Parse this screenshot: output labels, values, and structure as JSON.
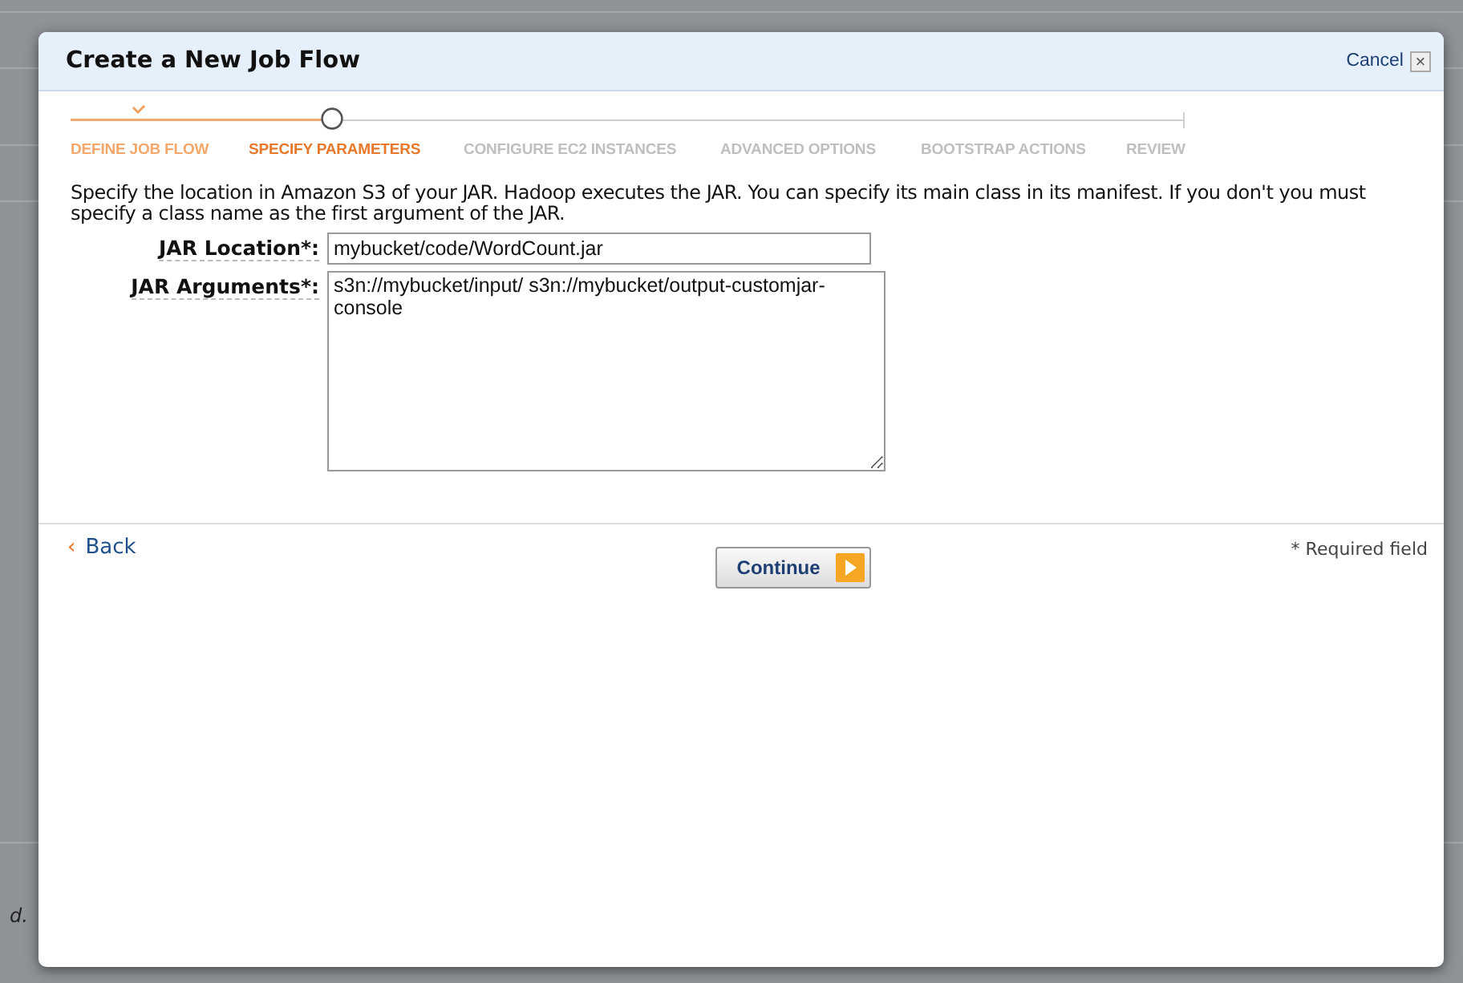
{
  "background": {
    "text_fragment": "d."
  },
  "dialog": {
    "title": "Create a New Job Flow",
    "cancel": "Cancel",
    "close_icon": "×"
  },
  "steps": [
    {
      "label": "DEFINE JOB FLOW",
      "completed": true,
      "selected": false
    },
    {
      "label": "SPECIFY PARAMETERS",
      "completed": false,
      "selected": true
    },
    {
      "label": "CONFIGURE EC2 INSTANCES",
      "completed": false,
      "selected": false
    },
    {
      "label": "ADVANCED OPTIONS",
      "completed": false,
      "selected": false
    },
    {
      "label": "BOOTSTRAP ACTIONS",
      "completed": false,
      "selected": false
    },
    {
      "label": "REVIEW",
      "completed": false,
      "selected": false
    }
  ],
  "description": "Specify the location in Amazon S3 of your JAR. Hadoop executes the JAR. You can specify its main class in its manifest. If you don't you must specify a class name as the first argument of the JAR.",
  "fields": [
    {
      "kind": "input",
      "label": "JAR Location*:",
      "value": "mybucket/code/WordCount.jar"
    },
    {
      "kind": "textarea",
      "label": "JAR Arguments*:",
      "value": "s3n://mybucket/input/ s3n://mybucket/output-customjar-console"
    }
  ],
  "footer": {
    "back": "Back",
    "back_icon": "‹",
    "continue": "Continue",
    "required_note": "* Required field"
  }
}
